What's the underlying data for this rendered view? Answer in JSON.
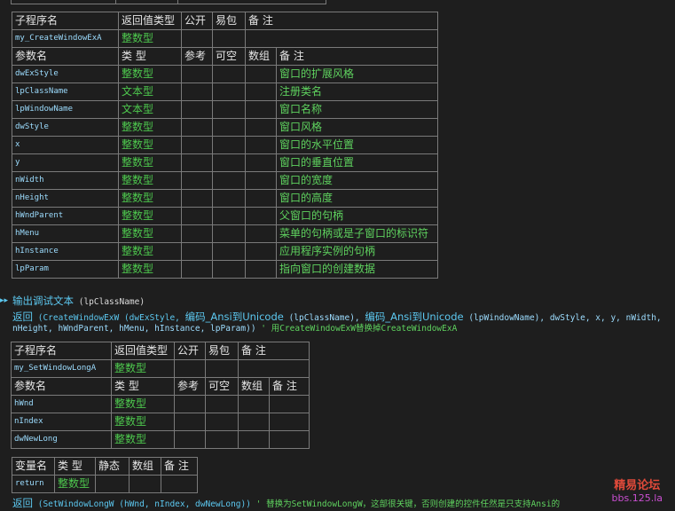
{
  "table1": {
    "header": [
      "子程序名",
      "返回值类型",
      "公开",
      "易包",
      "备 注"
    ],
    "sub": [
      "my_CreateWindowExA",
      "整数型",
      "",
      "",
      ""
    ],
    "param_header": [
      "参数名",
      "类 型",
      "参考",
      "可空",
      "数组",
      "备 注"
    ],
    "params": [
      [
        "dwExStyle",
        "整数型",
        "窗口的扩展风格"
      ],
      [
        "lpClassName",
        "文本型",
        "注册类名"
      ],
      [
        "lpWindowName",
        "文本型",
        "窗口名称"
      ],
      [
        "dwStyle",
        "整数型",
        "窗口风格"
      ],
      [
        "x",
        "整数型",
        "窗口的水平位置"
      ],
      [
        "y",
        "整数型",
        "窗口的垂直位置"
      ],
      [
        "nWidth",
        "整数型",
        "窗口的宽度"
      ],
      [
        "nHeight",
        "整数型",
        "窗口的高度"
      ],
      [
        "hWndParent",
        "整数型",
        "父窗口的句柄"
      ],
      [
        "hMenu",
        "整数型",
        "菜单的句柄或是子窗口的标识符"
      ],
      [
        "hInstance",
        "整数型",
        "应用程序实例的句柄"
      ],
      [
        "lpParam",
        "整数型",
        "指向窗口的创建数据"
      ]
    ]
  },
  "code": {
    "line1_cmd": "输出调试文本",
    "line1_args": "(lpClassName)",
    "line2_kw": "返回",
    "line2_a": "(CreateWindowExW (dwExStyle, ",
    "line2_fn1": "编码_Ansi到Unicode",
    "line2_b": " (lpClassName), ",
    "line2_fn2": "编码_Ansi到Unicode",
    "line2_c": " (lpWindowName), dwStyle, x, y, nWidth,",
    "line3_a": "nHeight, hWndParent, hMenu, hInstance, lpParam))",
    "line3_cmt": "  ' 用CreateWindowExW替换掉CreateWindowExA",
    "line4_kw": "返回",
    "line4_a": "(SetWindowLongW (hWnd, nIndex, dwNewLong))",
    "line4_cmt": "  ' 替换为SetWindowLongW，这部很关键，否则创建的控件任然是只支持Ansi的"
  },
  "table2": {
    "header": [
      "子程序名",
      "返回值类型",
      "公开",
      "易包",
      "备 注"
    ],
    "sub": [
      "my_SetWindowLongA",
      "整数型",
      "",
      "",
      ""
    ],
    "param_header": [
      "参数名",
      "类 型",
      "参考",
      "可空",
      "数组",
      "备 注"
    ],
    "params": [
      [
        "hWnd",
        "整数型"
      ],
      [
        "nIndex",
        "整数型"
      ],
      [
        "dwNewLong",
        "整数型"
      ]
    ]
  },
  "table3": {
    "header": [
      "变量名",
      "类 型",
      "静态",
      "数组",
      "备 注"
    ],
    "row": [
      "return",
      "整数型"
    ]
  },
  "watermark": {
    "line1": "精易论坛",
    "line2": "bbs.125.la"
  }
}
